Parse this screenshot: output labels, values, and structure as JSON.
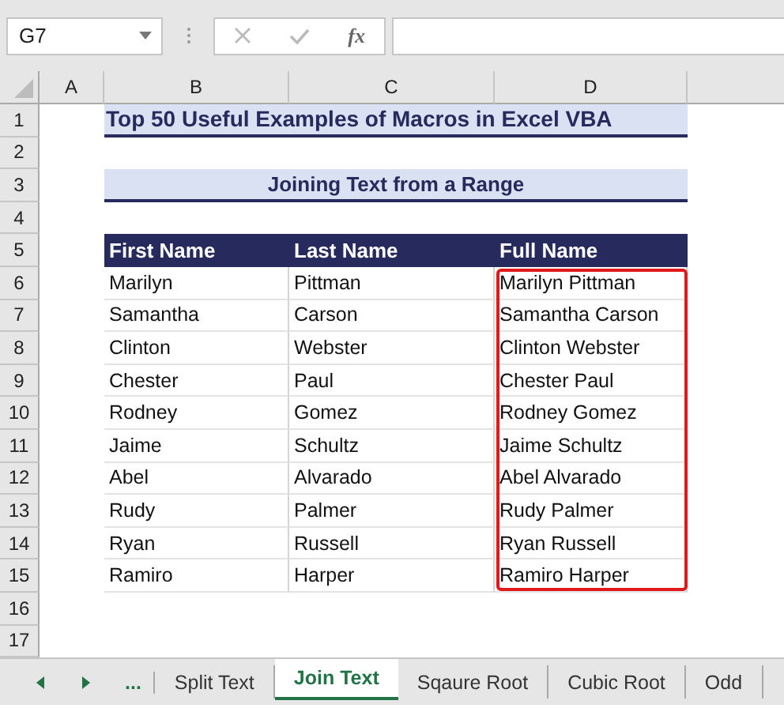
{
  "name_box": "G7",
  "formula_bar": {
    "function_label": "fx"
  },
  "columns": [
    "A",
    "B",
    "C",
    "D"
  ],
  "row_numbers": [
    "1",
    "2",
    "3",
    "4",
    "5",
    "6",
    "7",
    "8",
    "9",
    "10",
    "11",
    "12",
    "13",
    "14",
    "15",
    "16",
    "17"
  ],
  "title": "Top 50 Useful Examples of Macros in Excel VBA",
  "subtitle": "Joining Text from a Range",
  "table": {
    "columns": [
      "First Name",
      "Last Name",
      "Full Name"
    ],
    "rows": [
      [
        "Marilyn",
        "Pittman",
        "Marilyn Pittman"
      ],
      [
        "Samantha",
        "Carson",
        "Samantha Carson"
      ],
      [
        "Clinton",
        "Webster",
        "Clinton Webster"
      ],
      [
        "Chester",
        "Paul",
        "Chester Paul"
      ],
      [
        "Rodney",
        "Gomez",
        "Rodney Gomez"
      ],
      [
        "Jaime",
        "Schultz",
        "Jaime Schultz"
      ],
      [
        "Abel",
        "Alvarado",
        "Abel Alvarado"
      ],
      [
        "Rudy",
        "Palmer",
        "Rudy Palmer"
      ],
      [
        "Ryan",
        "Russell",
        "Ryan Russell"
      ],
      [
        "Ramiro",
        "Harper",
        "Ramiro Harper"
      ]
    ]
  },
  "sheet_nav": {
    "more": "..."
  },
  "sheet_tabs": [
    {
      "label": "Split Text",
      "selected": false
    },
    {
      "label": "Join Text",
      "selected": true
    },
    {
      "label": "Sqaure Root",
      "selected": false
    },
    {
      "label": "Cubic Root",
      "selected": false
    },
    {
      "label": "Odd",
      "selected": false
    }
  ]
}
